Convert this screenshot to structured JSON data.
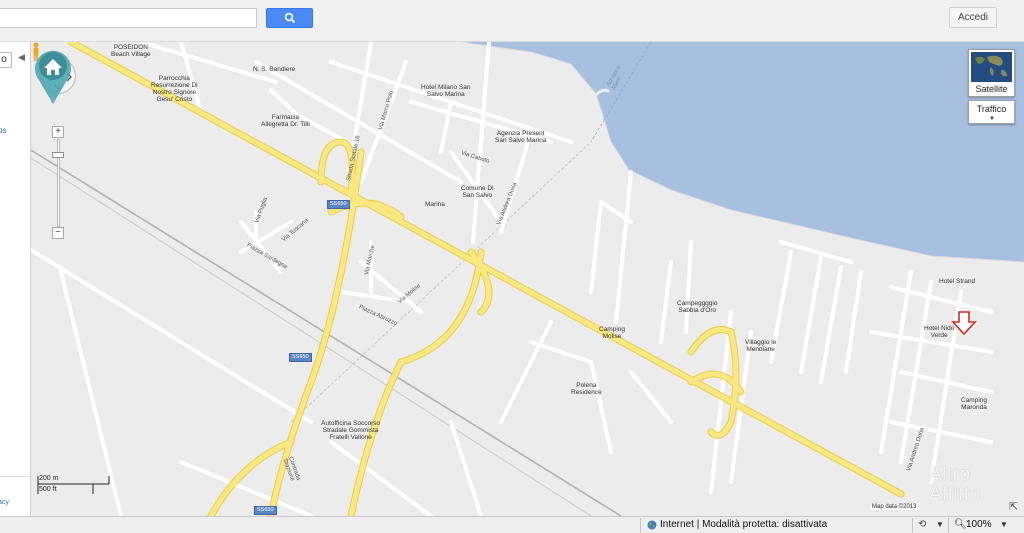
{
  "toolbar": {
    "search_value": "",
    "search_icon": "magnifier-icon",
    "signin_label": "Accedi"
  },
  "left_panel": {
    "tab_glyph": "o",
    "collapse_glyph": "◀",
    "link1": "ps",
    "link2": "acy"
  },
  "map": {
    "colors": {
      "sea": "#a8c0df",
      "land": "#ececec",
      "highway": "#fbe880",
      "highway_edge": "#e6cf4a",
      "road": "#ffffff",
      "rail": "#b2b2b2",
      "marker": "#d8281e"
    },
    "controls": {
      "pan": "pan-control",
      "zoom_in": "+",
      "zoom_out": "−",
      "satellite_label": "Satellite",
      "traffic_label": "Traffico"
    },
    "pois": [
      {
        "name": "poseidon",
        "text": "POSEIDON\nBeach Village"
      },
      {
        "name": "parrocchia",
        "text": "Parrocchia\nResurrezione Di\nNostro Signore\nGesu' Cristo"
      },
      {
        "name": "ns-bandiere",
        "text": "N. S. Bandiere"
      },
      {
        "name": "farmacia",
        "text": "Farmacia\nAllegretta Dr. Tilli"
      },
      {
        "name": "hotel-milano",
        "text": "Hotel Milano San\nSalvo Marina"
      },
      {
        "name": "agenzia",
        "text": "Agenzia Present\nSan Salvo Marina"
      },
      {
        "name": "comune",
        "text": "Comune Di\nSan Salvo"
      },
      {
        "name": "marina",
        "text": "Marina"
      },
      {
        "name": "campeggio-sabbia",
        "text": "Campeggggio\nSabbia d'Oro"
      },
      {
        "name": "camping-molise",
        "text": "Camping\nMolise"
      },
      {
        "name": "villaggio",
        "text": "Villaggio le\nMendiane"
      },
      {
        "name": "hotel-strand",
        "text": "Hotel Strand"
      },
      {
        "name": "hotel-nido",
        "text": "Hotel Nido\nVerde"
      },
      {
        "name": "camping-maronda",
        "text": "Camping\nMaronda"
      },
      {
        "name": "polena",
        "text": "Polena\nResidence"
      },
      {
        "name": "autofficina",
        "text": "Autofficina Soccorso\nStradale Gommista\nFratelli Vallone"
      }
    ],
    "streets": [
      {
        "name": "via-marco-polo",
        "text": "Via Marco Polo"
      },
      {
        "name": "strada-statale",
        "text": "Strada Statale 16"
      },
      {
        "name": "via-andrea-doria",
        "text": "Via Andrea Doria"
      },
      {
        "name": "via-caboto",
        "text": "Via Caboto"
      },
      {
        "name": "via-puglia",
        "text": "Via Puglia"
      },
      {
        "name": "via-toscana",
        "text": "Via Toscana"
      },
      {
        "name": "piazza-sardegna",
        "text": "Piazza Sardegna"
      },
      {
        "name": "via-marche",
        "text": "Via Marche"
      },
      {
        "name": "via-molise",
        "text": "Via Molise"
      },
      {
        "name": "piazza-abruzzo",
        "text": "Piazza Abruzzo"
      },
      {
        "name": "via-andrea-doria-2",
        "text": "Via Andrea Doria"
      },
      {
        "name": "contrada-stazione",
        "text": "Contrada\nStazione"
      },
      {
        "name": "coast-label",
        "text": "Adriatico\nMare"
      }
    ],
    "shields": [
      "SS650",
      "SS650",
      "SS650"
    ],
    "scale_metric": "200 m",
    "scale_imperial": "500 ft",
    "attribution": "Map data ©2013",
    "watermark": "Altro\nAffitto",
    "watermark_icon": "house-pin-icon",
    "location_marker_icon": "red-down-arrow-icon"
  },
  "statusbar": {
    "zone_text": "Internet | Modalità protetta: disattivata",
    "zoom_text": "100%",
    "zone_icon": "globe-icon"
  }
}
